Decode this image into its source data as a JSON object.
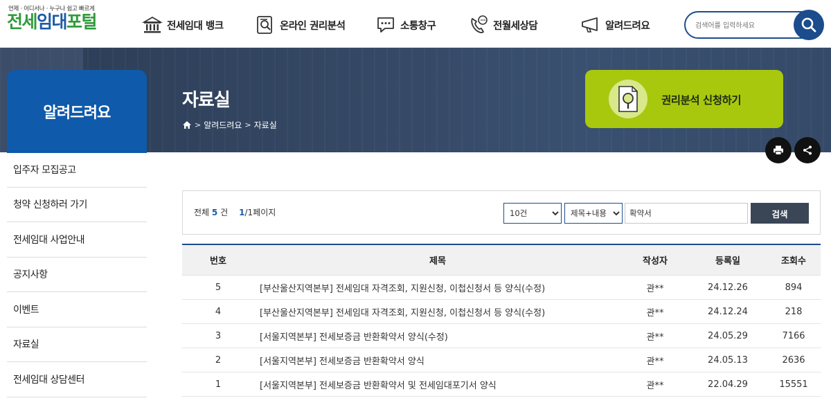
{
  "logo": {
    "tagline": "언제 · 어디서나 · 누구나 쉽고 빠르게",
    "part1": "전세",
    "part2": "임대",
    "part3": "포털"
  },
  "gnb": [
    {
      "label": "전세임대 뱅크",
      "icon": "bank-icon"
    },
    {
      "label": "온라인 권리분석",
      "icon": "document-search-icon"
    },
    {
      "label": "소통창구",
      "icon": "chat-icon"
    },
    {
      "label": "전월세상담",
      "icon": "phone-chat-icon"
    },
    {
      "label": "알려드려요",
      "icon": "megaphone-icon"
    }
  ],
  "search": {
    "placeholder": "검색어를 입력하세요"
  },
  "side_title": "알려드려요",
  "page_title": "자료실",
  "breadcrumb": {
    "level1": "알려드려요",
    "level2": "자료실"
  },
  "apply_button": "권리분석 신청하기",
  "lnb": [
    "입주자 모집공고",
    "청약 신청하러 가기",
    "전세임대 사업안내",
    "공지사항",
    "이벤트",
    "자료실",
    "전세임대 상담센터"
  ],
  "board": {
    "total_prefix": "전체",
    "total_count": "5",
    "total_suffix": "건",
    "page_current": "1",
    "page_rest": "/1페이지",
    "page_size_selected": "10건",
    "field_selected": "제목+내용",
    "keyword": "확약서",
    "search_button": "검색",
    "headers": {
      "no": "번호",
      "title": "제목",
      "writer": "작성자",
      "date": "등록일",
      "views": "조회수"
    },
    "rows": [
      {
        "no": "5",
        "title": "[부산울산지역본부] 전세임대 자격조회, 지원신청, 이첩신청서 등 양식(수정)",
        "writer": "관**",
        "date": "24.12.26",
        "views": "894"
      },
      {
        "no": "4",
        "title": "[부산울산지역본부] 전세임대 자격조회, 지원신청, 이첩신청서 등 양식(수정)",
        "writer": "관**",
        "date": "24.12.24",
        "views": "218"
      },
      {
        "no": "3",
        "title": "[서울지역본부] 전세보증금 반환확약서 양식(수정)",
        "writer": "관**",
        "date": "24.05.29",
        "views": "7166"
      },
      {
        "no": "2",
        "title": "[서울지역본부] 전세보증금 반환확약서 양식",
        "writer": "관**",
        "date": "24.05.13",
        "views": "2636"
      },
      {
        "no": "1",
        "title": "[서울지역본부] 전세보증금 반환확약서 및 전세임대포기서 양식",
        "writer": "관**",
        "date": "22.04.29",
        "views": "15551"
      }
    ]
  },
  "colors": {
    "primary": "#1b4c8c",
    "side": "#0f5aaa",
    "accent": "#a8c80e",
    "logo_green": "#2f9a3b",
    "logo_blue": "#1b5aa8"
  }
}
